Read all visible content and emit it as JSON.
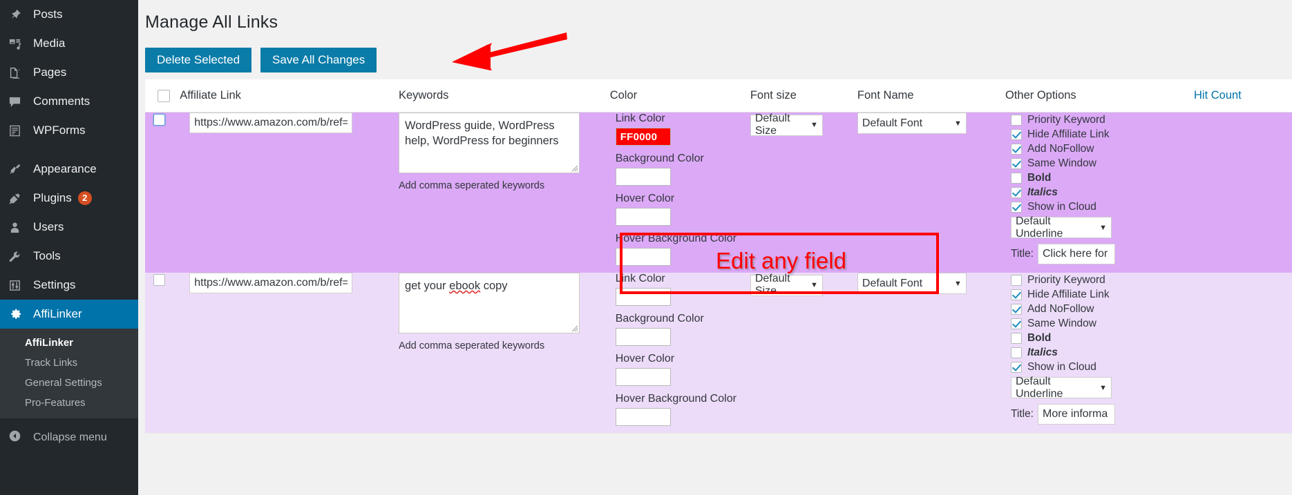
{
  "sidebar": {
    "items": [
      {
        "label": "Posts",
        "icon": "pin-icon"
      },
      {
        "label": "Media",
        "icon": "media-icon"
      },
      {
        "label": "Pages",
        "icon": "pages-icon"
      },
      {
        "label": "Comments",
        "icon": "comment-icon"
      },
      {
        "label": "WPForms",
        "icon": "form-icon"
      },
      {
        "label": "Appearance",
        "icon": "paintbrush-icon"
      },
      {
        "label": "Plugins",
        "icon": "plug-icon",
        "badge": "2"
      },
      {
        "label": "Users",
        "icon": "user-icon"
      },
      {
        "label": "Tools",
        "icon": "wrench-icon"
      },
      {
        "label": "Settings",
        "icon": "sliders-icon"
      },
      {
        "label": "AffiLinker",
        "icon": "gear-icon",
        "active": true
      }
    ],
    "submenu": [
      {
        "label": "AffiLinker",
        "current": true
      },
      {
        "label": "Track Links"
      },
      {
        "label": "General Settings"
      },
      {
        "label": "Pro-Features"
      }
    ],
    "collapse_label": "Collapse menu",
    "active_color": "#0073aa",
    "badge_color": "#d54e21"
  },
  "header": {
    "title": "Manage All Links",
    "buttons": {
      "delete_selected": "Delete Selected",
      "save_all_changes": "Save All Changes"
    },
    "button_color": "#0b7ca8"
  },
  "table": {
    "headers": {
      "affiliate_link": "Affiliate Link",
      "keywords": "Keywords",
      "color": "Color",
      "font_size": "Font size",
      "font_name": "Font Name",
      "other_options": "Other Options",
      "hit_count": "Hit Count"
    },
    "hit_count_color": "#0073aa",
    "color_labels": {
      "link": "Link Color",
      "background": "Background Color",
      "hover": "Hover Color",
      "hover_background": "Hover Background Color"
    },
    "keywords_hint": "Add comma seperated keywords",
    "title_label": "Title:",
    "rows": [
      {
        "row_bg": "#dca9f7",
        "selected": false,
        "url": "https://www.amazon.com/b/ref=ur",
        "keywords": "WordPress guide, WordPress help, WordPress for beginners",
        "link_color": "FF0000",
        "link_color_hex": "#FF0000",
        "background_color": "",
        "hover_color": "",
        "hover_background_color": "",
        "font_size": "Default Size",
        "font_name": "Default Font",
        "underline": "Default Underline",
        "title": "Click here for",
        "hit_count": "",
        "options": [
          {
            "label": "Priority Keyword",
            "checked": false,
            "style": "normal"
          },
          {
            "label": "Hide Affiliate Link",
            "checked": true,
            "style": "normal"
          },
          {
            "label": "Add NoFollow",
            "checked": true,
            "style": "normal"
          },
          {
            "label": "Same Window",
            "checked": true,
            "style": "normal"
          },
          {
            "label": "Bold",
            "checked": false,
            "style": "bold"
          },
          {
            "label": "Italics",
            "checked": true,
            "style": "italic"
          },
          {
            "label": "Show in Cloud",
            "checked": true,
            "style": "normal"
          }
        ]
      },
      {
        "row_bg": "#eddcf9",
        "selected": false,
        "url": "https://www.amazon.com/b/ref=ur",
        "keywords": "get your ebook copy",
        "keywords_misspelled": "ebook",
        "link_color": "",
        "link_color_hex": "#ffffff",
        "background_color": "",
        "hover_color": "",
        "hover_background_color": "",
        "font_size": "Default Size",
        "font_name": "Default Font",
        "underline": "Default Underline",
        "title": "More informa",
        "hit_count": "",
        "options": [
          {
            "label": "Priority Keyword",
            "checked": false,
            "style": "normal"
          },
          {
            "label": "Hide Affiliate Link",
            "checked": true,
            "style": "normal"
          },
          {
            "label": "Add NoFollow",
            "checked": true,
            "style": "normal"
          },
          {
            "label": "Same Window",
            "checked": true,
            "style": "normal"
          },
          {
            "label": "Bold",
            "checked": false,
            "style": "bold"
          },
          {
            "label": "Italics",
            "checked": false,
            "style": "italic"
          },
          {
            "label": "Show in Cloud",
            "checked": true,
            "style": "normal"
          }
        ]
      }
    ]
  },
  "annotations": {
    "callout_text": "Edit any field",
    "callout_color": "#ff0000",
    "arrow_color": "#ff0000"
  }
}
